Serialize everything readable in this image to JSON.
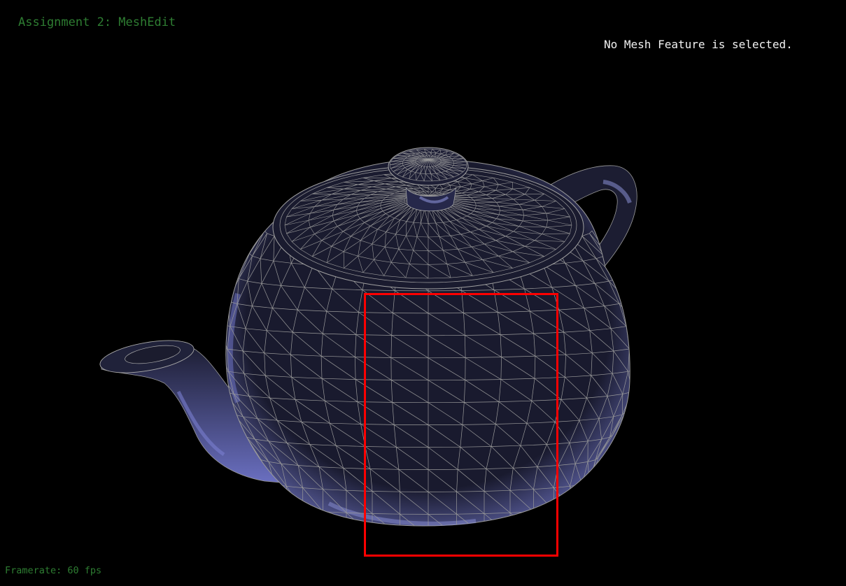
{
  "app": {
    "title": "Assignment 2: MeshEdit",
    "status": "No Mesh Feature is selected.",
    "framerate": "Framerate: 60 fps"
  },
  "viewport": {
    "background": "#000000",
    "mesh_name": "teapot",
    "render_mode": "shaded-wireframe",
    "mesh_fill_color": "#191a2e",
    "mesh_highlight_color": "#8a8fd6",
    "wire_color": "#9a9a9a"
  },
  "overlay": {
    "selection_box_color": "#ff0000"
  },
  "colors": {
    "title_text": "#2e7d32",
    "status_text": "#f2f2f2"
  }
}
